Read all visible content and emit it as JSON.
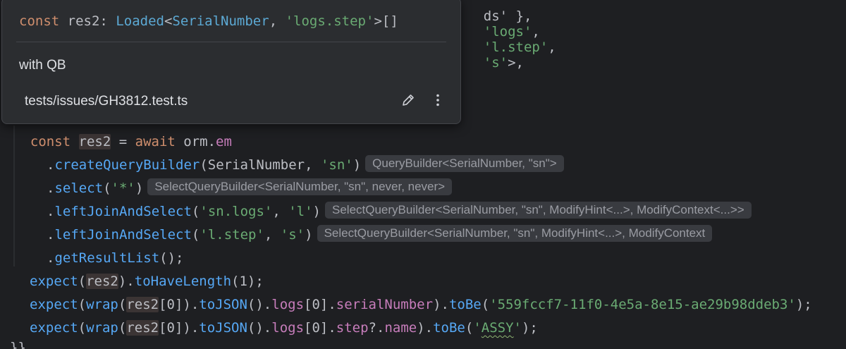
{
  "popup": {
    "signature": {
      "keyword": "const",
      "name": "res2",
      "colon": ":",
      "type_name": "Loaded",
      "lt": "<",
      "type_arg": "SerialNumber",
      "comma": ",",
      "string_arg": "'logs.step'",
      "suffix": ">[]"
    },
    "description": "with QB",
    "file_path": "tests/issues/GH3812.test.ts",
    "edit_icon": "pencil-icon",
    "more_icon": "more-vertical-icon"
  },
  "code": {
    "top_fragment": {
      "p1": "ds' },",
      "s1": "'logs'",
      "p2": ",",
      "s2": "'l.step'",
      "p3": ",",
      "s3": "'s'",
      "p4": ">,"
    },
    "lines": [
      {
        "indent": "  ",
        "kw": "const",
        "var": "res2",
        "eq": " = ",
        "kw2": "await",
        "obj": " orm.",
        "prop": "em"
      },
      {
        "dot": ".",
        "fn": "createQueryBuilder",
        "open": "(SerialNumber, ",
        "str": "'sn'",
        "close": ")",
        "hint": "QueryBuilder<SerialNumber, \"sn\">"
      },
      {
        "dot": ".",
        "fn": "select",
        "open": "(",
        "str": "'*'",
        "close": ")",
        "hint": "SelectQueryBuilder<SerialNumber, \"sn\", never, never>"
      },
      {
        "dot": ".",
        "fn": "leftJoinAndSelect",
        "open": "(",
        "str1": "'sn.logs'",
        "comma": ", ",
        "str2": "'l'",
        "close": ")",
        "hint": "SelectQueryBuilder<SerialNumber, \"sn\", ModifyHint<...>, ModifyContext<...>>"
      },
      {
        "dot": ".",
        "fn": "leftJoinAndSelect",
        "open": "(",
        "str1": "'l.step'",
        "comma": ", ",
        "str2": "'s'",
        "close": ")",
        "hint": "SelectQueryBuilder<SerialNumber, \"sn\", ModifyHint<...>, ModifyContext"
      },
      {
        "dot": ".",
        "fn": "getResultList",
        "close": "();"
      },
      {
        "fn": "expect",
        "open": "(",
        "var": "res2",
        "close": ").",
        "fn2": "toHaveLength",
        "args": "(1);"
      },
      {
        "fn": "expect",
        "open": "(",
        "fn2": "wrap",
        "open2": "(",
        "var": "res2",
        "idx": "[0]).",
        "fn3": "toJSON",
        "mid": "().",
        "prop": "logs",
        "idx2": "[0].",
        "prop2": "serialNumber",
        "close": ").",
        "fn4": "toBe",
        "open3": "(",
        "str": "'559fccf7-11f0-4e5a-8e15-ae29b98ddeb3'",
        "end": ");"
      },
      {
        "fn": "expect",
        "open": "(",
        "fn2": "wrap",
        "open2": "(",
        "var": "res2",
        "idx": "[0]).",
        "fn3": "toJSON",
        "mid": "().",
        "prop": "logs",
        "idx2": "[0].",
        "prop2": "step",
        "opt": "?.",
        "prop3": "name",
        "close": ").",
        "fn4": "toBe",
        "open3": "(",
        "str_q1": "'",
        "str_body": "ASSY",
        "str_q2": "'",
        "end": ");"
      }
    ],
    "bottom_fragment": "}}"
  },
  "colors": {
    "background": "#1e1f22",
    "popup_background": "#2b2d30",
    "keyword": "#cf8e6d",
    "function": "#56a8f5",
    "string": "#6aab73",
    "property": "#c77dbb",
    "type": "#5ca9d4",
    "hint_background": "#393b40"
  }
}
